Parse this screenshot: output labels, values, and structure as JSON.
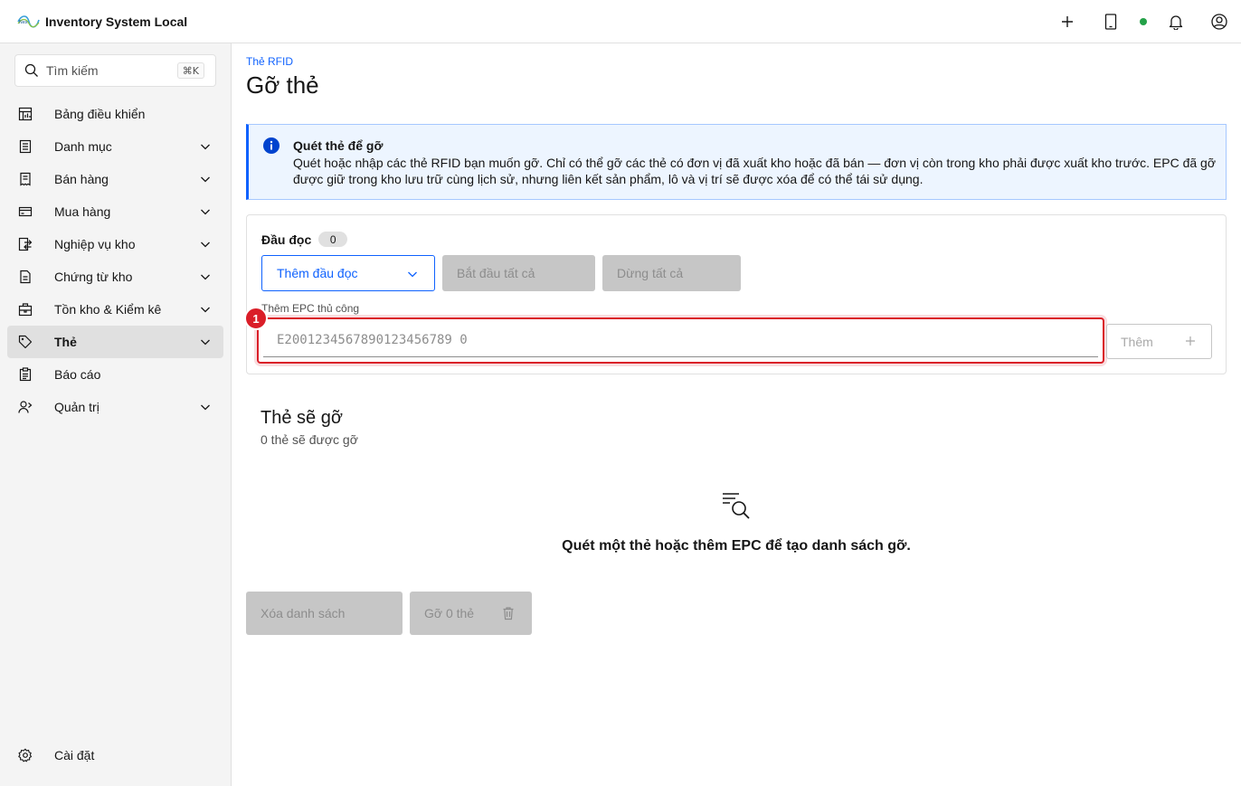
{
  "app": {
    "title": "Inventory System Local",
    "logo_icon": "brand-logo"
  },
  "header": {
    "actions": [
      {
        "icon": "add-icon"
      },
      {
        "icon": "tablet-icon"
      },
      {
        "icon": "status-dot",
        "color": "#24a148"
      },
      {
        "icon": "notification-bell-icon"
      },
      {
        "icon": "user-avatar-icon"
      }
    ]
  },
  "sidebar": {
    "search": {
      "placeholder": "Tìm kiếm",
      "shortcut": "⌘K"
    },
    "items": [
      {
        "label": "Bảng điều khiển",
        "icon": "dashboard-icon",
        "expandable": false
      },
      {
        "label": "Danh mục",
        "icon": "catalog-icon",
        "expandable": true
      },
      {
        "label": "Bán hàng",
        "icon": "receipt-icon",
        "expandable": true
      },
      {
        "label": "Mua hàng",
        "icon": "card-icon",
        "expandable": true
      },
      {
        "label": "Nghiệp vụ kho",
        "icon": "transfer-icon",
        "expandable": true
      },
      {
        "label": "Chứng từ kho",
        "icon": "document-icon",
        "expandable": true
      },
      {
        "label": "Tồn kho & Kiểm kê",
        "icon": "inventory-icon",
        "expandable": true
      },
      {
        "label": "Thẻ",
        "icon": "tag-icon",
        "expandable": true,
        "active": true
      },
      {
        "label": "Báo cáo",
        "icon": "report-icon",
        "expandable": false
      },
      {
        "label": "Quản trị",
        "icon": "admin-icon",
        "expandable": true
      }
    ],
    "settings": {
      "label": "Cài đặt",
      "icon": "settings-icon"
    }
  },
  "main": {
    "breadcrumb": "Thẻ RFID",
    "title": "Gỡ thẻ",
    "notification": {
      "title": "Quét thẻ để gỡ",
      "body": "Quét hoặc nhập các thẻ RFID bạn muốn gỡ. Chỉ có thể gỡ các thẻ có đơn vị đã xuất kho hoặc đã bán — đơn vị còn trong kho phải được xuất kho trước. EPC đã gỡ được giữ trong kho lưu trữ cùng lịch sử, nhưng liên kết sản phẩm, lô và vị trí sẽ được xóa để có thể tái sử dụng."
    },
    "readers": {
      "label": "Đầu đọc",
      "count": "0",
      "add_reader": "Thêm đầu đọc",
      "start_all": "Bắt đầu tất cả",
      "stop_all": "Dừng tất cả"
    },
    "manual_epc": {
      "label": "Thêm EPC thủ công",
      "placeholder": "E2001234567890123456789 0",
      "add_button": "Thêm",
      "marker": "1"
    },
    "list": {
      "title": "Thẻ sẽ gỡ",
      "subtitle": "0 thẻ sẽ được gỡ",
      "empty_text": "Quét một thẻ hoặc thêm EPC để tạo danh sách gỡ.",
      "clear_button": "Xóa danh sách",
      "remove_button": "Gỡ 0 thẻ"
    }
  }
}
